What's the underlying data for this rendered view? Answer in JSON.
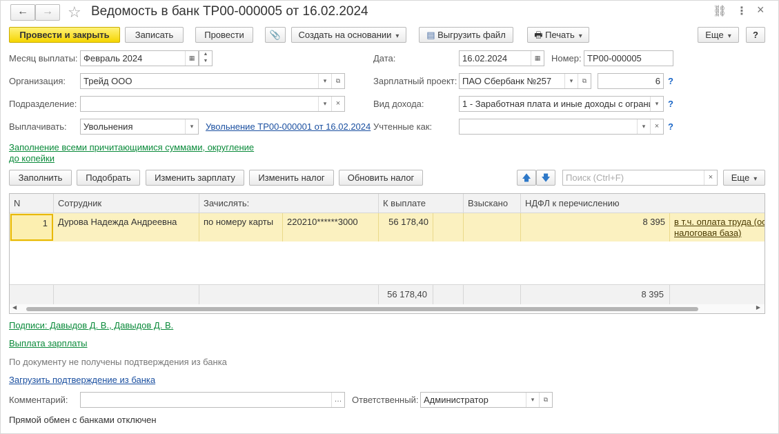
{
  "window": {
    "title": "Ведомость в банк ТР00-000005 от 16.02.2024",
    "back": "←",
    "forward": "→",
    "link_icon": "⛓",
    "more_icon": "⋮",
    "close_icon": "×"
  },
  "toolbar": {
    "post_close": "Провести и закрыть",
    "save": "Записать",
    "post": "Провести",
    "create_based": "Создать на основании",
    "export_file": "Выгрузить файл",
    "print": "Печать",
    "more": "Еще",
    "help": "?"
  },
  "form": {
    "month_label": "Месяц выплаты:",
    "month_value": "Февраль 2024",
    "date_label": "Дата:",
    "date_value": "16.02.2024",
    "number_label": "Номер:",
    "number_value": "ТР00-000005",
    "org_label": "Организация:",
    "org_value": "Трейд ООО",
    "salary_project_label": "Зарплатный проект:",
    "salary_project_value": "ПАО Сбербанк №257",
    "salary_project_num": "6",
    "division_label": "Подразделение:",
    "division_value": "",
    "income_type_label": "Вид дохода:",
    "income_type_value": "1 - Заработная плата и иные доходы с ограни",
    "pay_label": "Выплачивать:",
    "pay_value": "Увольнения",
    "pay_link": "Увольнение ТР00-000001 от 16.02.2024",
    "accounted_label": "Учтенные как:",
    "accounted_value": "",
    "fill_note_line1": "Заполнение всеми причитающимися суммами, округление",
    "fill_note_line2": "до копейки",
    "q": "?"
  },
  "table_toolbar": {
    "fill": "Заполнить",
    "pick": "Подобрать",
    "change_salary": "Изменить зарплату",
    "change_tax": "Изменить налог",
    "update_tax": "Обновить налог",
    "search_placeholder": "Поиск (Ctrl+F)",
    "more": "Еще",
    "up_icon": "🡅",
    "down_icon": "🡇"
  },
  "table": {
    "headers": [
      "N",
      "Сотрудник",
      "Зачислять:",
      "К выплате",
      "Взыскано",
      "НДФЛ к перечислению"
    ],
    "rows": [
      {
        "n": "1",
        "employee": "Дурова Надежда Андреевна",
        "method": "по номеру карты",
        "card": "220210******3000",
        "to_pay": "56 178,40",
        "collected": "",
        "ndfl": "8 395",
        "ndfl_link_line1": "в т.ч. оплата труда (ос",
        "ndfl_link_line2": "налоговая база)"
      }
    ],
    "footer": {
      "to_pay": "56 178,40",
      "ndfl": "8 395"
    }
  },
  "bottom": {
    "signatures": "Подписи: Давыдов Д. В., Давыдов Д. В.",
    "salary_payment": "Выплата зарплаты",
    "not_confirmed": "По документу не получены подтверждения из банка",
    "load_confirm": "Загрузить подтверждение из банка",
    "comment_label": "Комментарий:",
    "comment_value": "",
    "responsible_label": "Ответственный:",
    "responsible_value": "Администратор",
    "exchange_status": "Прямой обмен с банками отключен"
  }
}
